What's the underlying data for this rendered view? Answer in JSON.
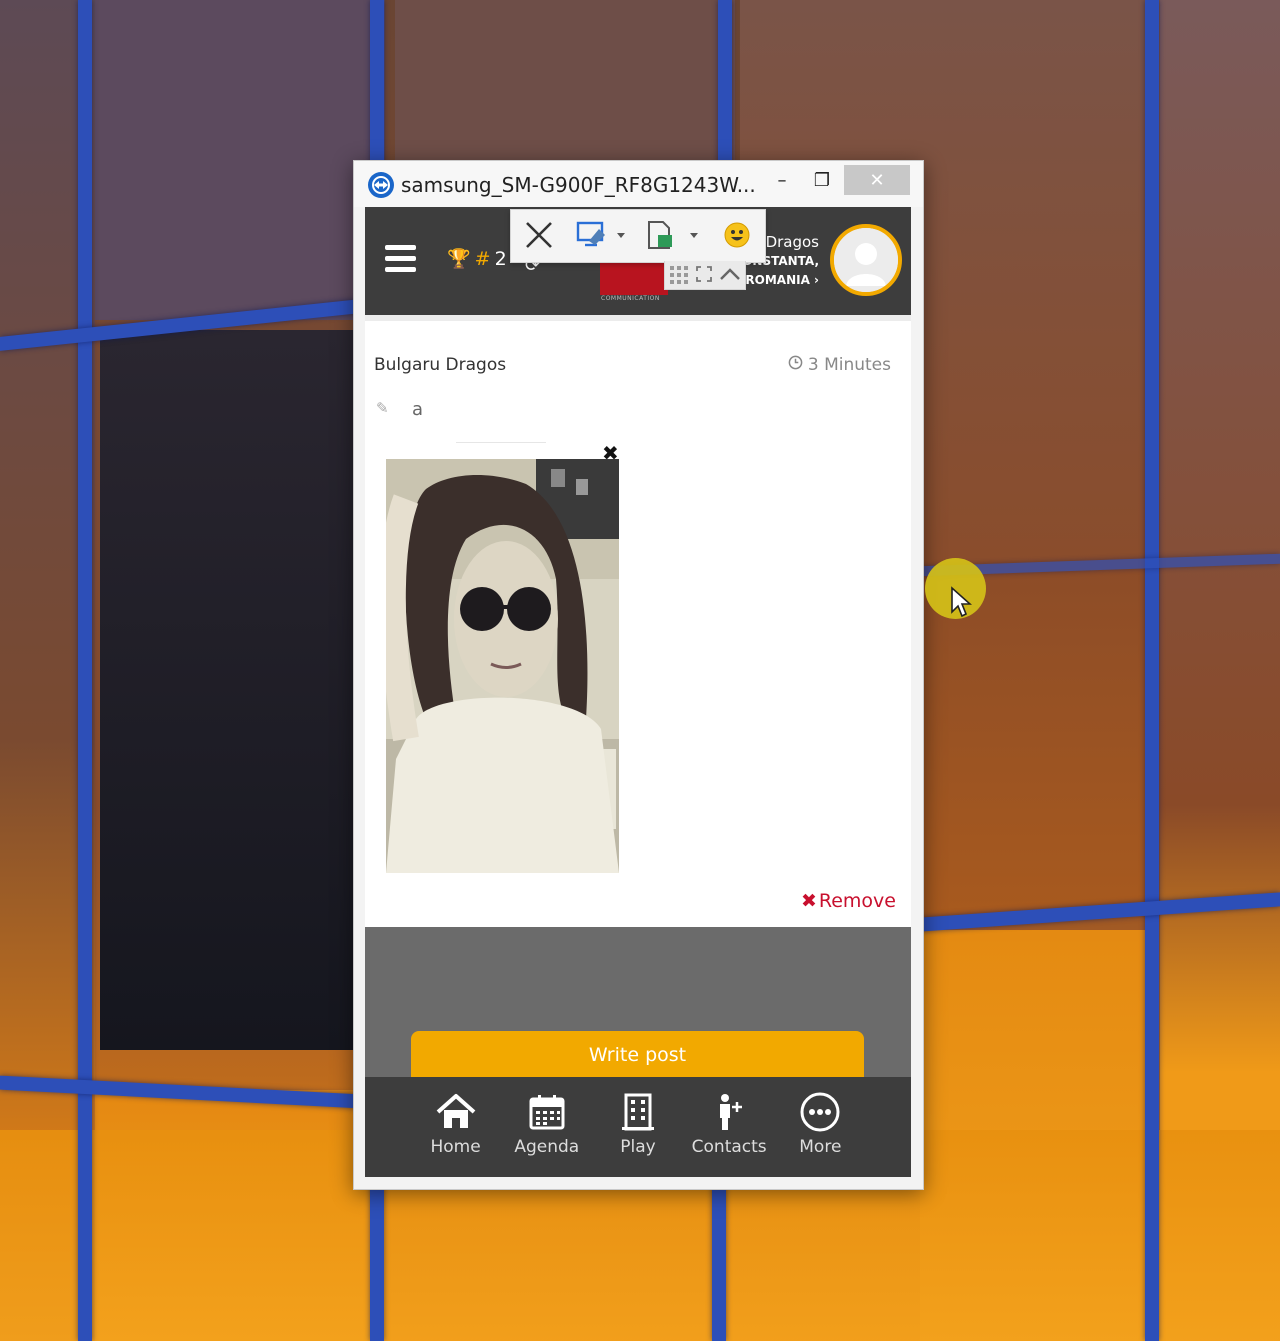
{
  "window": {
    "title": "samsung_SM-G900F_RF8G1243W...",
    "minimize_glyph": "–",
    "maximize_glyph": "❐",
    "close_glyph": "✕"
  },
  "remote_toolbar": {
    "icons": [
      "close-session-icon",
      "remote-actions-icon",
      "files-extras-icon",
      "emoji-icon",
      "collapse-icon"
    ]
  },
  "app_header": {
    "rank_hash": "#",
    "rank_value": "2",
    "user_name": "Dragos",
    "user_city": "ONSTANTA,",
    "user_country": "ROMANIA ›",
    "brand_caption": "COMMUNICATION"
  },
  "post": {
    "author": "Bulgaru Dragos",
    "time": "3 Minutes",
    "text": "a",
    "photo_close": "✖",
    "remove_icon": "✖",
    "remove_label": "Remove"
  },
  "compose": {
    "write_post_label": "Write post"
  },
  "bottom_nav": {
    "items": [
      {
        "label": "Home",
        "icon": "home-icon"
      },
      {
        "label": "Agenda",
        "icon": "calendar-icon"
      },
      {
        "label": "Play",
        "icon": "building-icon"
      },
      {
        "label": "Contacts",
        "icon": "add-contact-icon"
      },
      {
        "label": "More",
        "icon": "more-icon"
      }
    ]
  },
  "colors": {
    "accent": "#f2a900",
    "header_bg": "#3d3d3d",
    "remove": "#c8102e",
    "wallpaper_frame": "#2d4fb8"
  }
}
